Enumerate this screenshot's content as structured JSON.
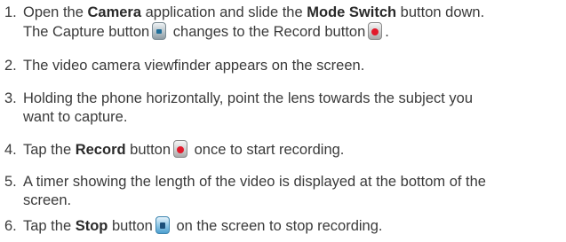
{
  "steps": [
    {
      "num": "1.",
      "p1": "Open the ",
      "b1": "Camera",
      "p2": " application and slide the ",
      "b2": "Mode Switch",
      "p3": " button down.",
      "p4": "The Capture button",
      "p5": " changes to the Record button",
      "p6": "."
    },
    {
      "num": "2.",
      "text": "The video camera viewfinder appears on the screen."
    },
    {
      "num": "3.",
      "line1": "Holding the phone horizontally, point the lens towards the subject you",
      "line2": "want to capture."
    },
    {
      "num": "4.",
      "p1": "Tap the ",
      "b1": "Record",
      "p2": " button",
      "p3": " once to start recording."
    },
    {
      "num": "5.",
      "line1": "A timer showing the length of the video is displayed at the bottom of the",
      "line2": "screen."
    },
    {
      "num": "6.",
      "p1": "Tap the ",
      "b1": "Stop",
      "p2": " button",
      "p3": " on the screen to stop recording."
    }
  ],
  "icons": {
    "capture": "capture-button-icon",
    "record": "record-button-icon",
    "stop": "stop-button-icon"
  },
  "colors": {
    "text": "#3a3a3a",
    "record_dot": "#e2192b",
    "stop_blue": "#4c9fcf"
  }
}
